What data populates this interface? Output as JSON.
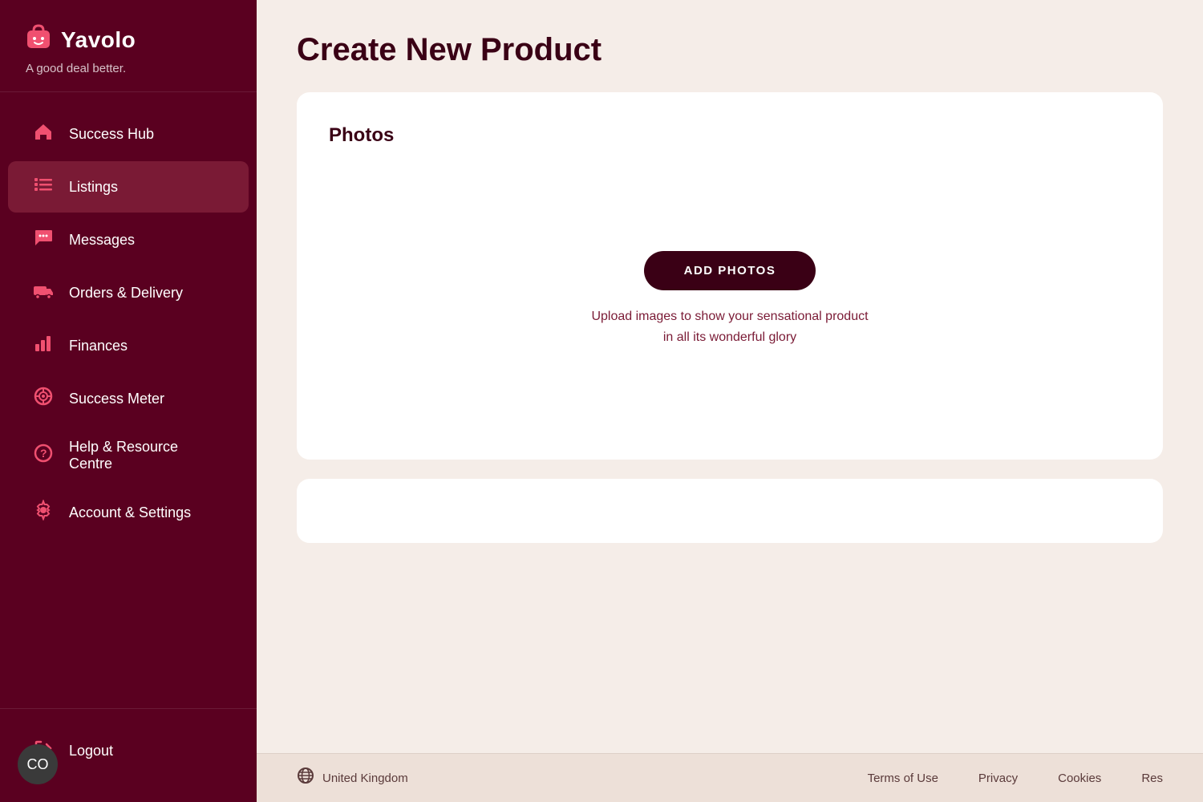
{
  "app": {
    "logo_icon": "☺",
    "logo_text": "Yavolo",
    "tagline": "A good deal better."
  },
  "sidebar": {
    "nav_items": [
      {
        "id": "success-hub",
        "label": "Success Hub",
        "icon": "home",
        "active": false
      },
      {
        "id": "listings",
        "label": "Listings",
        "icon": "list",
        "active": true
      },
      {
        "id": "messages",
        "label": "Messages",
        "icon": "chat",
        "active": false
      },
      {
        "id": "orders-delivery",
        "label": "Orders & Delivery",
        "icon": "truck",
        "active": false
      },
      {
        "id": "finances",
        "label": "Finances",
        "icon": "bar-chart",
        "active": false
      },
      {
        "id": "success-meter",
        "label": "Success Meter",
        "icon": "target",
        "active": false
      },
      {
        "id": "help-resource",
        "label": "Help & Resource Centre",
        "icon": "help",
        "active": false
      },
      {
        "id": "account-settings",
        "label": "Account & Settings",
        "icon": "gear",
        "active": false
      }
    ],
    "bottom_items": [
      {
        "id": "logout",
        "label": "Logout",
        "icon": "logout"
      }
    ]
  },
  "main": {
    "page_title": "Create New Product",
    "photos_section": {
      "title": "Photos",
      "add_photos_button": "ADD PHOTOS",
      "helper_text_line1": "Upload images to show your sensational product",
      "helper_text_line2": "in all its wonderful glory"
    }
  },
  "footer": {
    "region": "United Kingdom",
    "links": [
      {
        "id": "terms",
        "label": "Terms of Use"
      },
      {
        "id": "privacy",
        "label": "Privacy"
      },
      {
        "id": "cookies",
        "label": "Cookies"
      },
      {
        "id": "res",
        "label": "Res"
      }
    ]
  },
  "chat_fab": {
    "label": "CO"
  }
}
